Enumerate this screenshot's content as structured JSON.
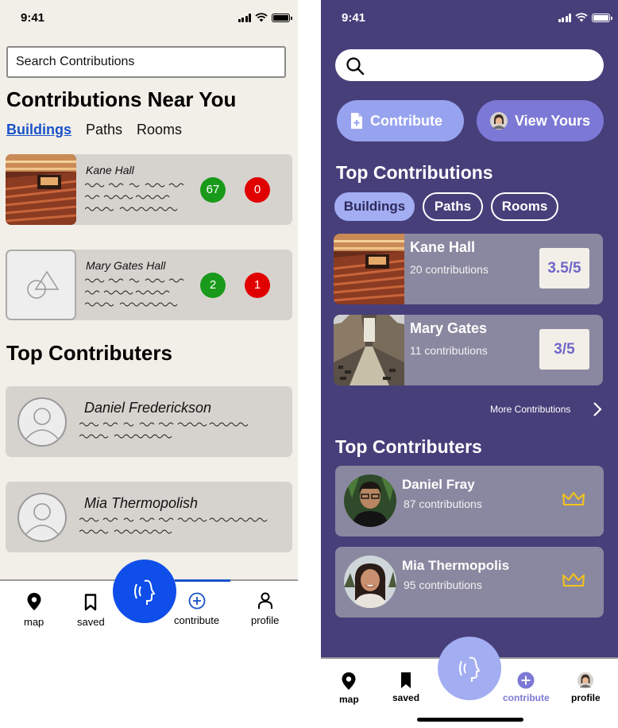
{
  "left": {
    "status": {
      "time": "9:41"
    },
    "search": {
      "value": "Search Contributions"
    },
    "title": "Contributions Near You",
    "tabs": [
      {
        "label": "Buildings",
        "active": true
      },
      {
        "label": "Paths",
        "active": false
      },
      {
        "label": "Rooms",
        "active": false
      }
    ],
    "buildings": [
      {
        "name": "Kane Hall",
        "up": "67",
        "down": "0",
        "image": "auditorium-photo"
      },
      {
        "name": "Mary Gates Hall",
        "up": "2",
        "down": "1",
        "image": "placeholder-shapes-icon"
      }
    ],
    "top_title": "Top Contributers",
    "contributors": [
      {
        "name": "Daniel Frederickson"
      },
      {
        "name": "Mia Thermopolish"
      }
    ],
    "nav": {
      "map": "map",
      "saved": "saved",
      "contribute": "contribute",
      "profile": "profile"
    },
    "colors": {
      "accent": "#1a52c9",
      "fab": "#0f4ee8",
      "up": "#1a9a1a",
      "down": "#e00000",
      "background": "#f2efe8"
    }
  },
  "right": {
    "status": {
      "time": "9:41"
    },
    "search": {
      "placeholder": ""
    },
    "actions": {
      "contribute": "Contribute",
      "view_yours": "View Yours"
    },
    "top_title": "Top Contributions",
    "chips": [
      {
        "label": "Buildings",
        "active": true
      },
      {
        "label": "Paths",
        "active": false
      },
      {
        "label": "Rooms",
        "active": false
      }
    ],
    "buildings": [
      {
        "name": "Kane Hall",
        "count": "20 contributions",
        "rating": "3.5/5",
        "image": "auditorium-photo"
      },
      {
        "name": "Mary Gates",
        "count": "11 contributions",
        "rating": "3/5",
        "image": "atrium-photo"
      }
    ],
    "more": "More Contributions",
    "contrib_title": "Top Contributers",
    "contributors": [
      {
        "name": "Daniel Fray",
        "count": "87 contributions"
      },
      {
        "name": "Mia Thermopolis",
        "count": "95 contributions"
      }
    ],
    "nav": {
      "map": "map",
      "saved": "saved",
      "contribute": "contribute",
      "profile": "profile"
    },
    "colors": {
      "background": "#473f7a",
      "pill_contribute": "#98a3f0",
      "pill_view": "#7c79d6",
      "card": "#8a88a0",
      "crown": "#f5c518",
      "fab": "#a3adf2"
    }
  }
}
